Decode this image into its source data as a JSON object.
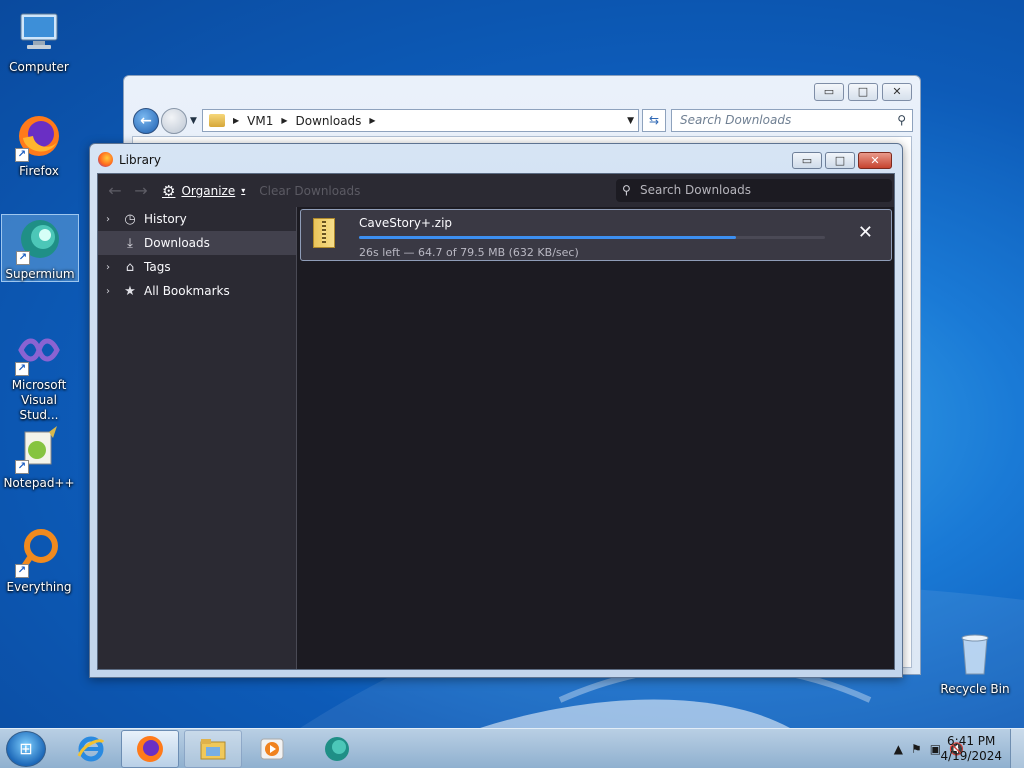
{
  "desktop": {
    "icons": [
      {
        "label": "Computer",
        "icon": "computer-icon"
      },
      {
        "label": "Firefox",
        "icon": "firefox-icon"
      },
      {
        "label": "Supermium",
        "icon": "supermium-icon"
      },
      {
        "label": "Microsoft Visual Stud...",
        "icon": "visual-studio-icon"
      },
      {
        "label": "Notepad++",
        "icon": "notepadpp-icon"
      },
      {
        "label": "Everything",
        "icon": "everything-icon"
      },
      {
        "label": "Recycle Bin",
        "icon": "recycle-bin-icon"
      }
    ]
  },
  "explorer": {
    "breadcrumb": [
      "VM1",
      "Downloads"
    ],
    "search_placeholder": "Search Downloads",
    "controls": {
      "minimize": "▭",
      "maximize": "□",
      "close": "✕"
    }
  },
  "library": {
    "title": "Library",
    "controls": {
      "minimize": "▭",
      "maximize": "□",
      "close": "✕"
    },
    "toolbar": {
      "organize_label": "Organize",
      "clear_label": "Clear Downloads",
      "search_placeholder": "Search Downloads"
    },
    "sidebar": [
      {
        "label": "History",
        "icon": "clock-icon",
        "expandable": true
      },
      {
        "label": "Downloads",
        "icon": "download-icon",
        "expandable": false,
        "active": true
      },
      {
        "label": "Tags",
        "icon": "tag-icon",
        "expandable": true
      },
      {
        "label": "All Bookmarks",
        "icon": "star-icon",
        "expandable": true
      }
    ],
    "download": {
      "filename": "CaveStory+.zip",
      "status": "26s left — 64.7 of 79.5 MB (632 KB/sec)",
      "progress": 0.81,
      "icon": "zip-file-icon"
    }
  },
  "taskbar": {
    "apps": [
      "internet-explorer-icon",
      "firefox-icon",
      "file-explorer-icon",
      "media-player-icon",
      "supermium-icon"
    ],
    "time": "6:41 PM",
    "date": "4/19/2024"
  },
  "colors": {
    "accent": "#3c8ff0",
    "library_bg": "#1c1b22",
    "library_toolbar": "#2b2a33"
  }
}
